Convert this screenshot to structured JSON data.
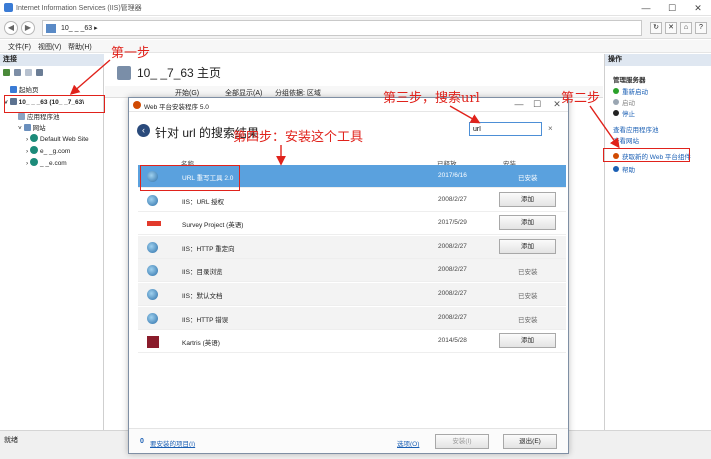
{
  "window": {
    "title": "Internet Information Services (IIS)管理器",
    "minimize": "—",
    "maximize": "☐",
    "close": "✕"
  },
  "address": {
    "path": "10_ _ _63 ▸"
  },
  "menu": [
    "文件(F)",
    "视图(V)",
    "帮助(H)"
  ],
  "left": {
    "header": "连接",
    "tree": [
      {
        "label": "起始页"
      },
      {
        "label": "10_ _ _63 (10_ _7_63\\"
      },
      {
        "label": "应用程序池"
      },
      {
        "label": "网站"
      },
      {
        "label": "Default Web Site"
      },
      {
        "label": "e_ _g.com"
      },
      {
        "label": "_ _e.com"
      }
    ]
  },
  "center": {
    "title": "10_ _7_63 主页",
    "bar_items": [
      "开始(G)",
      "全部显示(A)",
      "分组依据: 区域"
    ]
  },
  "right": {
    "header": "操作",
    "section": "管理服务器",
    "actions": [
      {
        "label": "重新启动",
        "color": "#2aa12a"
      },
      {
        "label": "启动",
        "color": "#9aa6b2"
      },
      {
        "label": "停止",
        "color": "#222222"
      },
      {
        "label": "查看应用程序池",
        "color": ""
      },
      {
        "label": "查看网站",
        "color": ""
      },
      {
        "label": "获取新的 Web 平台组件",
        "color": "#d04a02"
      },
      {
        "label": "帮助",
        "color": "#1a5fb4"
      }
    ]
  },
  "status": "就绪",
  "dialog": {
    "title": "Web 平台安装程序 5.0",
    "heading": "针对 url 的搜索结果",
    "search_value": "url",
    "clear": "×",
    "columns": {
      "name": "名称",
      "released": "已释放",
      "install": "安装"
    },
    "rows": [
      {
        "name": "URL 重写工具 2.0",
        "date": "2017/6/16",
        "action": "已安装",
        "installed": true,
        "selected": true,
        "icon": "url-rewrite-icon"
      },
      {
        "name": "IIS：URL 授权",
        "date": "2008/2/27",
        "action": "添加",
        "installed": false,
        "icon": "iis-globe-icon"
      },
      {
        "name": "Survey Project (英语)",
        "date": "2017/5/29",
        "action": "添加",
        "installed": false,
        "icon": "survey-project-icon"
      },
      {
        "name": "IIS：HTTP 重定向",
        "date": "2008/2/27",
        "action": "添加",
        "installed": false,
        "icon": "iis-globe-icon"
      },
      {
        "name": "IIS：目录浏览",
        "date": "2008/2/27",
        "action": "已安装",
        "installed": true,
        "icon": "iis-globe-icon"
      },
      {
        "name": "IIS：默认文档",
        "date": "2008/2/27",
        "action": "已安装",
        "installed": true,
        "icon": "iis-globe-icon"
      },
      {
        "name": "IIS：HTTP 错误",
        "date": "2008/2/27",
        "action": "已安装",
        "installed": true,
        "icon": "iis-globe-icon"
      },
      {
        "name": "Kartris (英语)",
        "date": "2014/5/28",
        "action": "添加",
        "installed": false,
        "icon": "kartris-icon"
      }
    ],
    "footer": {
      "count": "0",
      "items_link": "要安装的项目(I)",
      "options": "选项(O)",
      "install": "安装(I)",
      "exit": "退出(E)"
    }
  },
  "annotations": {
    "step1": "第一步",
    "step2": "第二步",
    "step3": "第三步，搜索url",
    "step4": "第四步：安装这个工具"
  },
  "colors": {
    "annotation": "#e0221b",
    "selection": "#5aa1de"
  }
}
